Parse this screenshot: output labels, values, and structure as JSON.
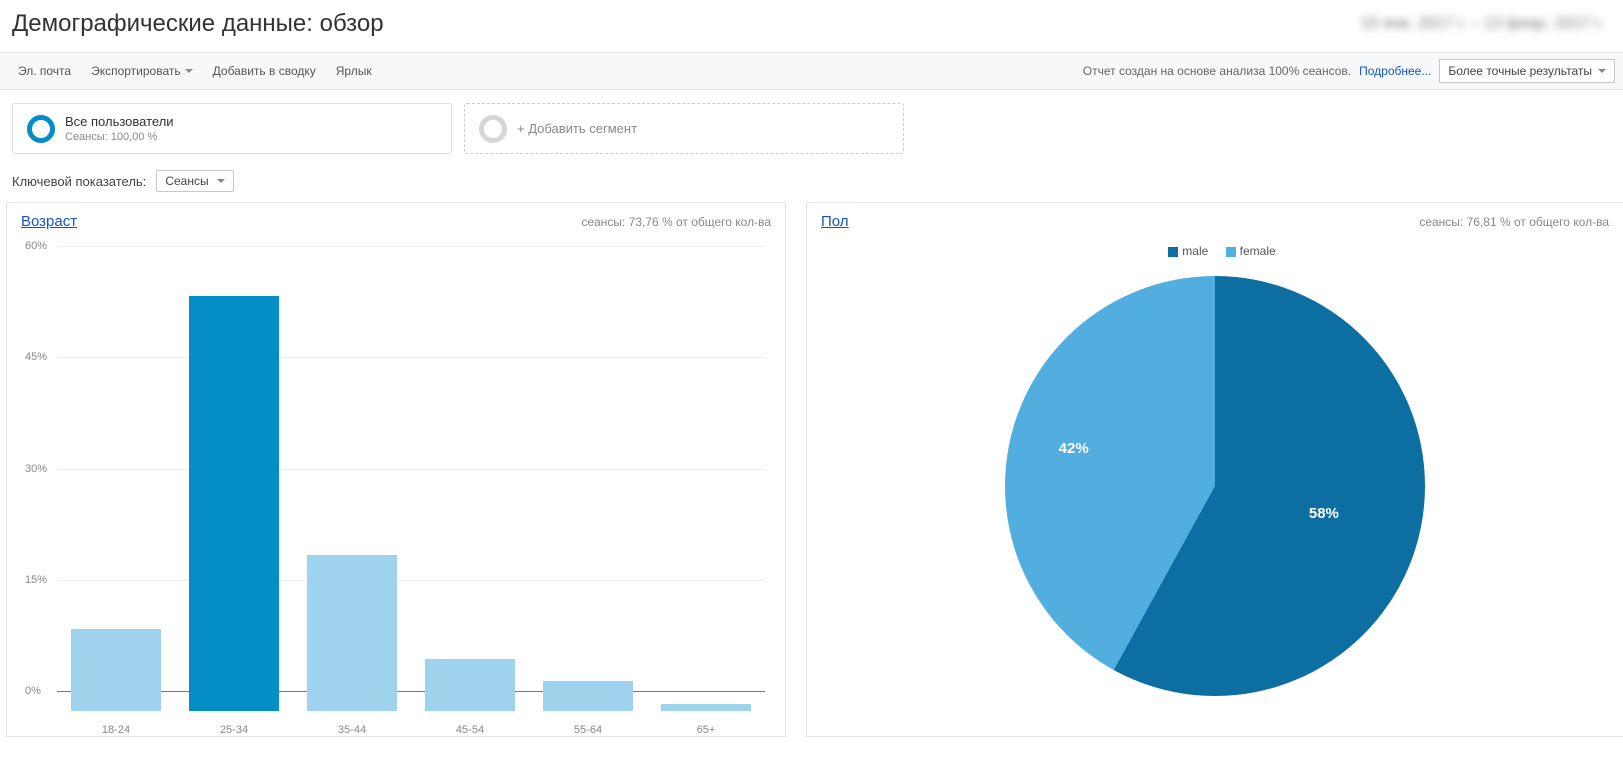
{
  "header": {
    "title": "Демографические данные: обзор",
    "date_range": "15 янв. 2017 г. – 13 февр. 2017 г."
  },
  "toolbar": {
    "email": "Эл. почта",
    "export": "Экспортировать",
    "add_to_report": "Добавить в сводку",
    "shortcut": "Ярлык",
    "report_info": "Отчет создан на основе анализа 100% сеансов.",
    "more_link": "Подробнее...",
    "precision": "Более точные результаты"
  },
  "segments": {
    "all_users_title": "Все пользователи",
    "all_users_sub": "Сеансы: 100,00 %",
    "add_segment": "+ Добавить сегмент"
  },
  "metric": {
    "label": "Ключевой показатель:",
    "value": "Сеансы"
  },
  "age_panel": {
    "title": "Возраст",
    "summary": "сеансы: 73,76 % от общего кол-ва"
  },
  "gender_panel": {
    "title": "Пол",
    "summary": "сеансы: 76,81 % от общего кол-ва",
    "legend_male": "male",
    "legend_female": "female",
    "label_male": "58%",
    "label_female": "42%"
  },
  "colors": {
    "dark_blue": "#0d6ea1",
    "light_blue": "#51aede",
    "pale_blue": "#9fd3ed"
  },
  "chart_data": [
    {
      "type": "bar",
      "title": "Возраст",
      "ylabel": "%",
      "ylim": [
        0,
        60
      ],
      "y_ticks": [
        0,
        15,
        30,
        45,
        60
      ],
      "categories": [
        "18-24",
        "25-34",
        "35-44",
        "45-54",
        "55-64",
        "65+"
      ],
      "values": [
        11,
        56,
        21,
        7,
        4,
        1
      ],
      "highlight_index": 1,
      "bar_color": "#9fd3ed",
      "highlight_color": "#058dc7"
    },
    {
      "type": "pie",
      "title": "Пол",
      "series": [
        {
          "name": "male",
          "value": 58,
          "color": "#0d6ea1"
        },
        {
          "name": "female",
          "value": 42,
          "color": "#51aede"
        }
      ]
    }
  ]
}
